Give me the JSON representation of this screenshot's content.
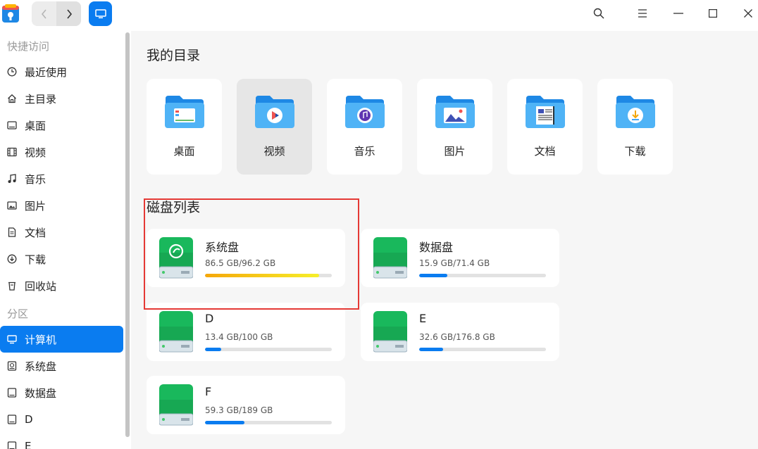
{
  "toolbar": {
    "back_icon": "chevron-left-icon",
    "forward_icon": "chevron-right-icon",
    "view_icon": "computer-icon",
    "search_icon": "search-icon",
    "menu_icon": "menu-icon",
    "minimize_icon": "minimize-icon",
    "maximize_icon": "maximize-icon",
    "close_icon": "close-icon"
  },
  "sidebar": {
    "quick_access_heading": "快捷访问",
    "quick_items": [
      {
        "label": "最近使用",
        "icon": "clock-icon"
      },
      {
        "label": "主目录",
        "icon": "home-icon"
      },
      {
        "label": "桌面",
        "icon": "desktop-icon"
      },
      {
        "label": "视频",
        "icon": "film-icon"
      },
      {
        "label": "音乐",
        "icon": "music-icon"
      },
      {
        "label": "图片",
        "icon": "image-icon"
      },
      {
        "label": "文档",
        "icon": "document-icon"
      },
      {
        "label": "下载",
        "icon": "download-icon"
      },
      {
        "label": "回收站",
        "icon": "trash-icon"
      }
    ],
    "partition_heading": "分区",
    "partition_items": [
      {
        "label": "计算机",
        "icon": "computer-icon",
        "active": true
      },
      {
        "label": "系统盘",
        "icon": "system-disk-icon"
      },
      {
        "label": "数据盘",
        "icon": "disk-icon"
      },
      {
        "label": "D",
        "icon": "disk-icon"
      },
      {
        "label": "E",
        "icon": "disk-icon"
      }
    ]
  },
  "main": {
    "my_dirs_title": "我的目录",
    "dirs": [
      {
        "label": "桌面",
        "icon": "desktop-folder-icon"
      },
      {
        "label": "视频",
        "icon": "video-folder-icon",
        "selected": true
      },
      {
        "label": "音乐",
        "icon": "music-folder-icon"
      },
      {
        "label": "图片",
        "icon": "picture-folder-icon"
      },
      {
        "label": "文档",
        "icon": "document-folder-icon"
      },
      {
        "label": "下载",
        "icon": "download-folder-icon"
      }
    ],
    "disks_title": "磁盘列表",
    "disks": [
      {
        "name": "系统盘",
        "size": "86.5 GB/96.2 GB",
        "usage": 0.9,
        "system": true
      },
      {
        "name": "数据盘",
        "size": "15.9 GB/71.4 GB",
        "usage": 0.22
      },
      {
        "name": "D",
        "size": "13.4 GB/100 GB",
        "usage": 0.13
      },
      {
        "name": "E",
        "size": "32.6 GB/176.8 GB",
        "usage": 0.19
      },
      {
        "name": "F",
        "size": "59.3 GB/189 GB",
        "usage": 0.31
      }
    ]
  },
  "colors": {
    "accent": "#0a7cf0",
    "usage_normal": "#0a7cf0",
    "usage_warning_start": "#f5a70a",
    "usage_warning_end": "#f6ef2a",
    "highlight_box": "#e53935",
    "disk_green": "#19b85c"
  }
}
